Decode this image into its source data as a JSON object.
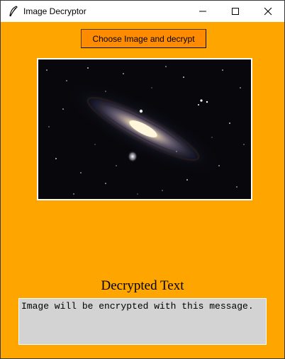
{
  "window": {
    "title": "Image Decryptor",
    "controls": {
      "minimize": "minimize-icon",
      "maximize": "maximize-icon",
      "close": "close-icon"
    }
  },
  "actions": {
    "choose_button_label": "Choose Image and decrypt"
  },
  "image": {
    "content": "galaxy photograph"
  },
  "result": {
    "label": "Decrypted Text",
    "text": "Image will be encrypted with this message."
  },
  "colors": {
    "background": "#ffa500",
    "button": "#ff8c00",
    "textbox": "#d3d3d3"
  }
}
